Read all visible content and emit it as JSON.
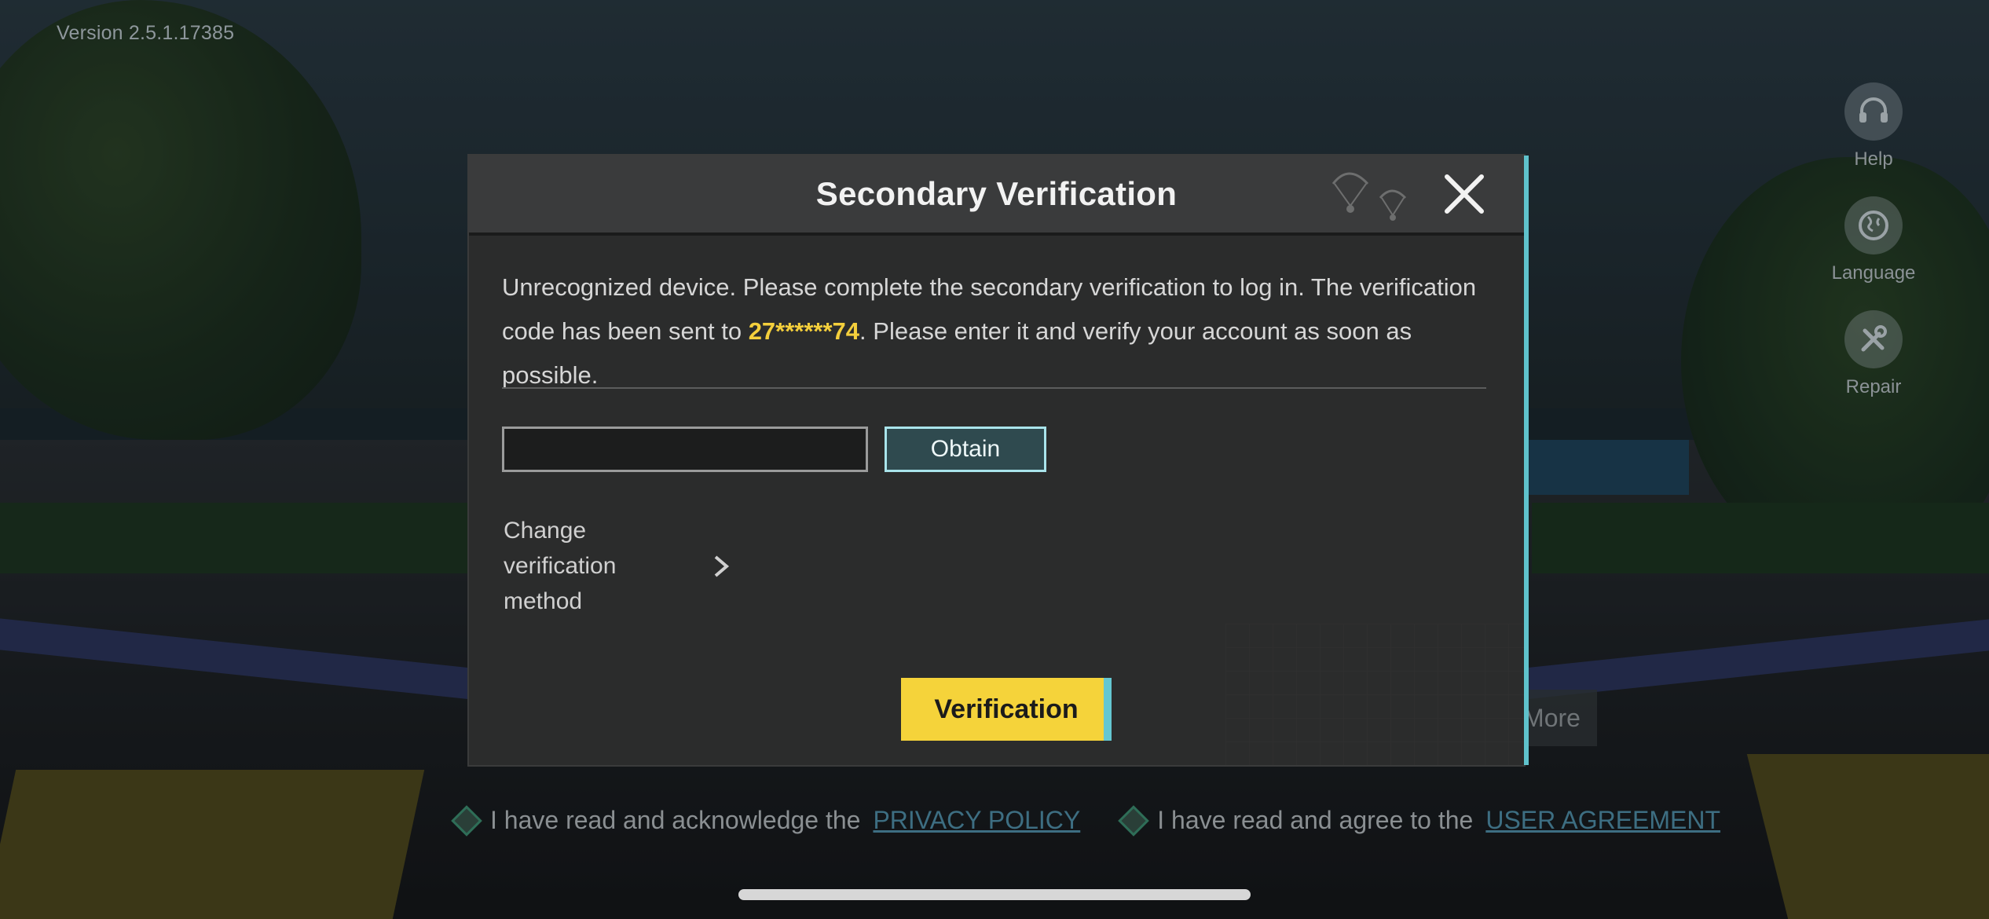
{
  "app": {
    "version": "Version 2.5.1.17385"
  },
  "side_tools": [
    {
      "label": "Help",
      "icon": "headset-icon"
    },
    {
      "label": "Language",
      "icon": "globe-icon"
    },
    {
      "label": "Repair",
      "icon": "wrench-icon"
    }
  ],
  "more_label": "More",
  "agreements": {
    "privacy_text": "I have read and acknowledge the",
    "privacy_link": "PRIVACY POLICY",
    "user_text": "I have read and agree to the",
    "user_link": "USER AGREEMENT"
  },
  "dialog": {
    "title": "Secondary Verification",
    "message_part1": "Unrecognized device. Please complete the secondary verification to log in. The verification code has been sent to ",
    "masked_number": "27******74",
    "message_part2": ". Please enter it and verify your account as soon as possible.",
    "code_input_value": "",
    "obtain_label": "Obtain",
    "change_method_label": "Change verification method",
    "verify_label": "Verification"
  },
  "colors": {
    "accent_yellow": "#f5d33a",
    "accent_cyan": "#64c7d1",
    "dialog_bg": "#2b2c2c"
  }
}
